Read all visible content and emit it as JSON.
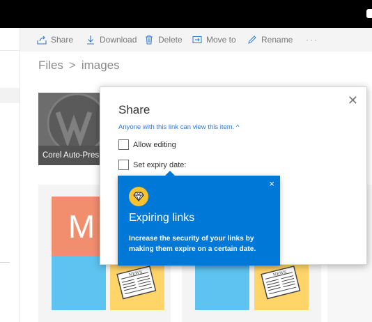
{
  "toolbar": {
    "share_label": "Share",
    "download_label": "Download",
    "delete_label": "Delete",
    "move_label": "Move to",
    "rename_label": "Rename",
    "more_label": "···"
  },
  "breadcrumb": {
    "root": "Files",
    "separator": ">",
    "current": "images"
  },
  "folder_tile": {
    "caption": "Corel Auto-Pres"
  },
  "doc_tile": {
    "letter": "M"
  },
  "share_dialog": {
    "title": "Share",
    "permission_text": "Anyone with this link can view this item.",
    "permission_chevron": "^",
    "allow_editing_label": "Allow editing",
    "allow_editing_checked": false,
    "set_expiry_label": "Set expiry date:",
    "set_expiry_checked": false,
    "close_glyph": "✕"
  },
  "callout": {
    "title": "Expiring links",
    "body": "Increase the security of your links by making them expire on a certain date.",
    "close_glyph": "×",
    "icon": "diamond-icon"
  },
  "colors": {
    "callout_bg": "#0078d7",
    "link_blue": "#2b78d0",
    "tile_orange": "#f08e6e",
    "tile_blue": "#5ec3f0",
    "tile_yellow": "#ffd56a",
    "gem_yellow": "#f9c22e"
  }
}
